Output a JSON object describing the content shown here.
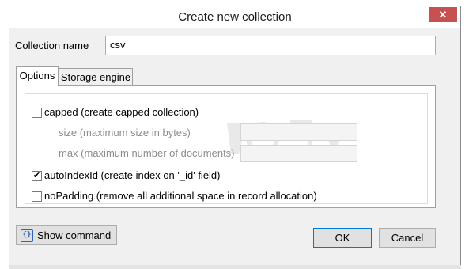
{
  "window": {
    "title": "Create new collection",
    "close_glyph": "✕"
  },
  "form": {
    "collection_name_label": "Collection name",
    "collection_name_value": "csv"
  },
  "tabs": [
    {
      "label": "Options",
      "active": true
    },
    {
      "label": "Storage engine",
      "active": false
    }
  ],
  "options": {
    "capped": {
      "label": "capped (create capped collection)",
      "checked": false
    },
    "size": {
      "label": "size (maximum size in bytes)",
      "value": ""
    },
    "max": {
      "label": "max (maximum number of documents)",
      "value": ""
    },
    "autoIndexId": {
      "label": "autoIndexId (create index on '_id' field)",
      "checked": true,
      "check_glyph": "✔"
    },
    "noPadding": {
      "label": "noPadding (remove all additional space in record allocation)",
      "checked": false
    }
  },
  "buttons": {
    "show_command": "Show command",
    "braces_glyph": "{}",
    "ok": "OK",
    "cancel": "Cancel"
  },
  "colors": {
    "close_button": "#c75050",
    "ok_border": "#0078d7",
    "icon_blue": "#2f63b5"
  }
}
